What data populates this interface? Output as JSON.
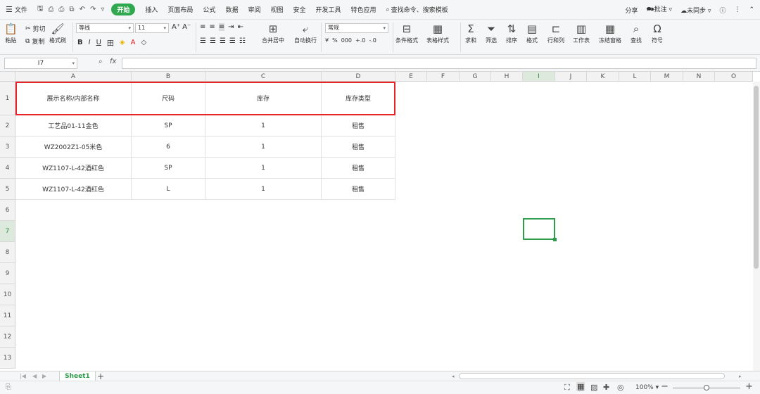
{
  "menu": {
    "file": "文件",
    "tabs": [
      "开始",
      "插入",
      "页面布局",
      "公式",
      "数据",
      "审阅",
      "视图",
      "安全",
      "开发工具",
      "特色应用"
    ],
    "search": "查找命令、搜索模板",
    "share": "分享",
    "comment": "批注",
    "sync": "未同步"
  },
  "ribbon": {
    "paste": "粘贴",
    "cut": "剪切",
    "copy": "复制",
    "format_painter": "格式刷",
    "font_name": "等线",
    "font_size": "11",
    "merge": "合并居中",
    "wrap": "自动换行",
    "number_format": "常规",
    "cond_format": "条件格式",
    "table_style": "表格样式",
    "sum": "求和",
    "filter": "筛选",
    "sort": "排序",
    "format": "格式",
    "rowcol": "行和列",
    "worksheet": "工作表",
    "freeze": "冻结窗格",
    "find": "查找",
    "symbol": "符号"
  },
  "formula_bar": {
    "cell_ref": "I7",
    "fx": "fx",
    "content": ""
  },
  "columns": [
    "A",
    "B",
    "C",
    "D",
    "E",
    "F",
    "G",
    "H",
    "I",
    "J",
    "K",
    "L",
    "M",
    "N",
    "O"
  ],
  "rows": [
    "1",
    "2",
    "3",
    "4",
    "5",
    "6",
    "7",
    "8",
    "9",
    "10",
    "11",
    "12",
    "13"
  ],
  "table": {
    "headers": [
      "展示名称/内部名称",
      "尺码",
      "库存",
      "库存类型"
    ],
    "data": [
      [
        "工艺品01-11金色",
        "SP",
        "1",
        "租售"
      ],
      [
        "WZ2002Z1-05米色",
        "6",
        "1",
        "租售"
      ],
      [
        "WZ1107-L-42酒红色",
        "SP",
        "1",
        "租售"
      ],
      [
        "WZ1107-L-42酒红色",
        "L",
        "1",
        "租售"
      ]
    ]
  },
  "sheet_tabs": [
    "Sheet1"
  ],
  "status": {
    "zoom": "100%"
  },
  "colors": {
    "accent": "#2fa84f",
    "highlight": "#e8242a"
  }
}
